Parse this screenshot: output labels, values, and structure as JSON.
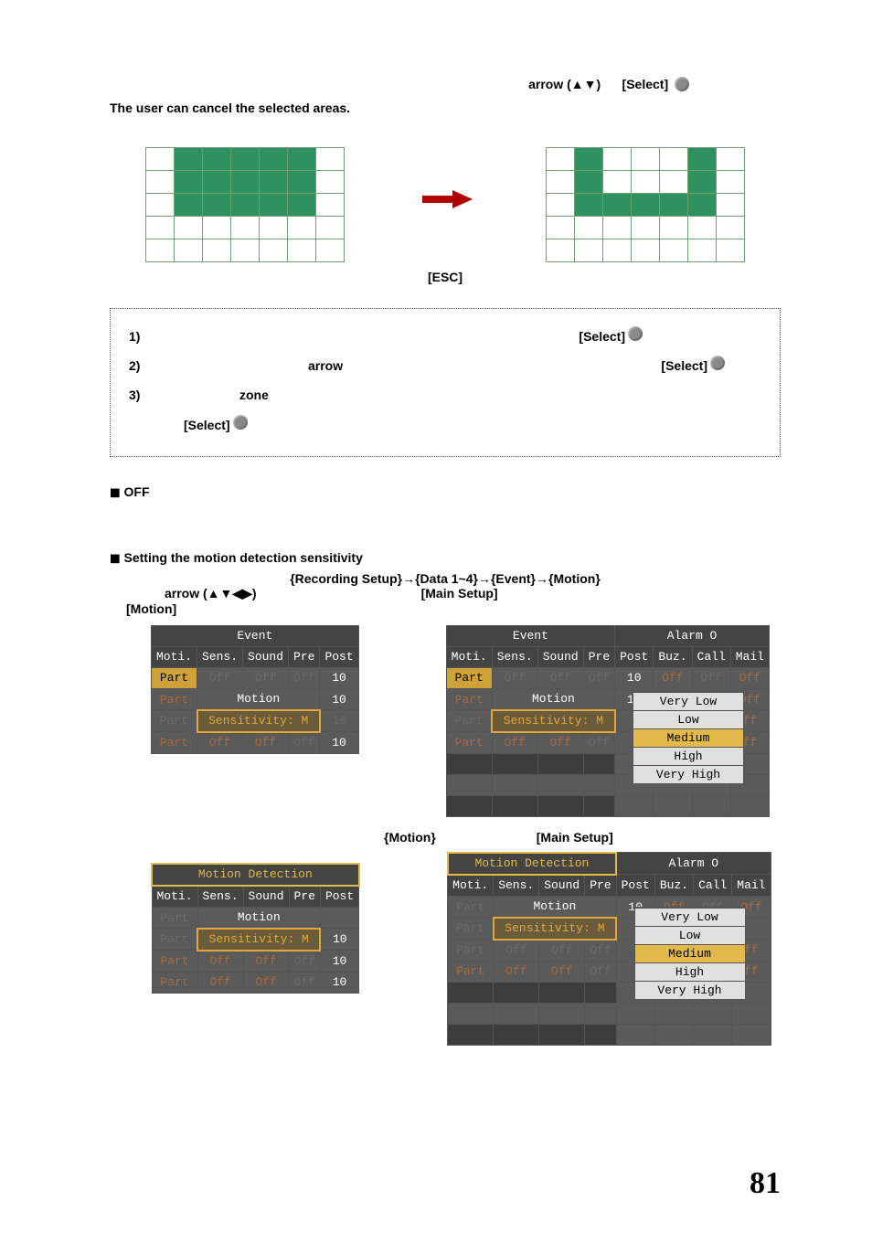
{
  "top_line": {
    "arrow": "arrow (▲▼)",
    "select": "[Select]"
  },
  "cancel_text": "The user can cancel the selected areas.",
  "esc_label": "[ESC]",
  "steps": {
    "s1": {
      "num": "1)",
      "select": "[Select]"
    },
    "s2": {
      "num": "2)",
      "arrow": "arrow",
      "select": "[Select]"
    },
    "s3": {
      "num": "3)",
      "zone": "zone",
      "select": "[Select]"
    }
  },
  "off_heading": "OFF",
  "sensitivity_heading": "Setting the motion detection sensitivity",
  "path": "{Recording Setup}→{Data 1~4}→{Event}→{Motion}",
  "arrow_dirs": "arrow (▲▼◀▶)",
  "main_setup": "[Main Setup]",
  "motion_label": "[Motion]",
  "pair_labels": {
    "left": "{Motion}",
    "right": "[Main Setup]"
  },
  "menu": {
    "event": "Event",
    "alarm": "Alarm O",
    "motion_det": "Motion Detection",
    "motion": "Motion",
    "sensitivity": "Sensitivity: M",
    "cols_small": [
      "Moti.",
      "Sens.",
      "Sound",
      "Pre",
      "Post"
    ],
    "cols_wide": [
      "Moti.",
      "Sens.",
      "Sound",
      "Pre",
      "Post",
      "Buz.",
      "Call",
      "Mail"
    ],
    "part": "Part",
    "off": "Off",
    "ten": "10",
    "ff": "ff",
    "opts": [
      "Very Low",
      "Low",
      "Medium",
      "High",
      "Very High"
    ]
  },
  "page_num": "81"
}
